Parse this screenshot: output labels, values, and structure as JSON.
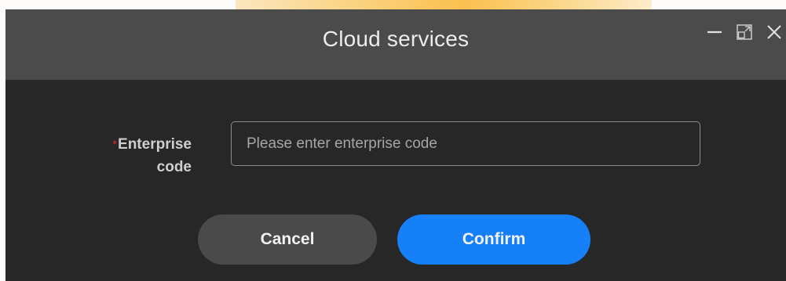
{
  "window": {
    "title": "Cloud services",
    "controls": {
      "minimize_icon": "minimize-icon",
      "restore_icon": "restore-icon",
      "close_icon": "close-icon"
    }
  },
  "form": {
    "required_mark": "*",
    "label_line1": "Enterprise",
    "label_line2": "code",
    "input_value": "",
    "input_placeholder": "Please enter enterprise code"
  },
  "actions": {
    "cancel_label": "Cancel",
    "confirm_label": "Confirm"
  },
  "colors": {
    "titlebar": "#4b4b4b",
    "body": "#272727",
    "accent": "#1580f7",
    "required": "#e02828"
  }
}
